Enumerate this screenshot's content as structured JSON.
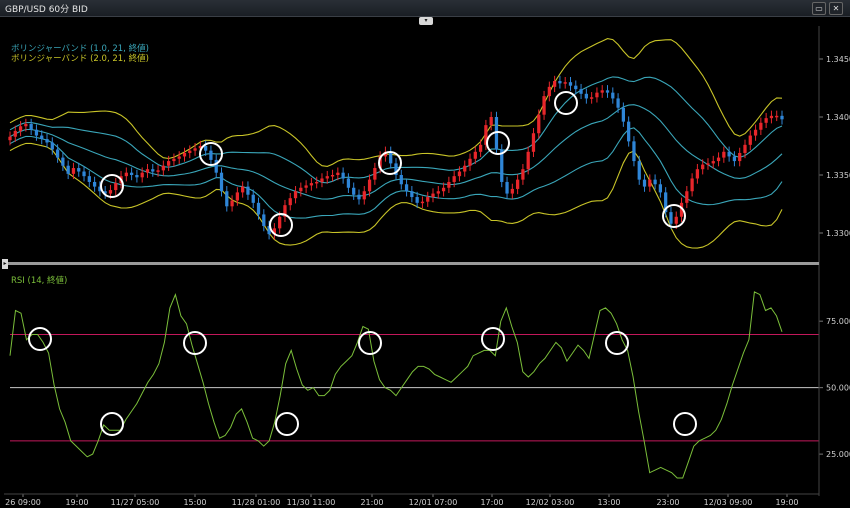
{
  "window": {
    "title": "GBP/USD 60分 BID",
    "close_icon": "close-icon",
    "restore_icon": "restore-icon",
    "collapse_icon": "collapse-icon"
  },
  "colors": {
    "bull": "#e8262b",
    "bear": "#2f86d8",
    "band1": "#3aa6b9",
    "band2": "#c8c428",
    "rsi": "#7bbf3a",
    "rsi_level_hi": "#c2185b",
    "rsi_level_mid": "#c8c8c8",
    "circle": "#ffffff"
  },
  "legend": {
    "bb1": "ボリンジャーバンド (1.0, 21, 終値)",
    "bb2": "ボリンジャーバンド (2.0, 21, 終値)",
    "rsi": "RSI (14, 終値)"
  },
  "chart_data": [
    {
      "type": "candlestick",
      "title": "GBP/USD 60分 BID",
      "ylim": [
        1.3275,
        1.3475
      ],
      "y_ticks": [
        "1.34500",
        "1.34000",
        "1.33500",
        "1.33000"
      ],
      "x_tick_labels": [
        "26 09:00",
        "19:00",
        "11/27 05:00",
        "15:00",
        "11/28 01:00",
        "11/30 11:00",
        "21:00",
        "12/01 07:00",
        "17:00",
        "12/02 03:00",
        "13:00",
        "23:00",
        "12/03 09:00",
        "19:00"
      ],
      "close": [
        1.3383,
        1.3388,
        1.3392,
        1.3394,
        1.3389,
        1.3384,
        1.3381,
        1.3378,
        1.3372,
        1.3365,
        1.3358,
        1.3351,
        1.3356,
        1.3353,
        1.3349,
        1.3344,
        1.334,
        1.3336,
        1.3334,
        1.3337,
        1.3343,
        1.3349,
        1.3352,
        1.335,
        1.3348,
        1.3352,
        1.3355,
        1.3353,
        1.3354,
        1.3358,
        1.3362,
        1.3364,
        1.3366,
        1.3369,
        1.3371,
        1.3373,
        1.3375,
        1.3371,
        1.3363,
        1.3352,
        1.3336,
        1.3323,
        1.3328,
        1.3335,
        1.334,
        1.3333,
        1.3326,
        1.3316,
        1.3306,
        1.3299,
        1.3304,
        1.3314,
        1.3324,
        1.333,
        1.3336,
        1.3339,
        1.3341,
        1.3343,
        1.3344,
        1.3347,
        1.3349,
        1.335,
        1.3352,
        1.3347,
        1.3339,
        1.3333,
        1.3329,
        1.3336,
        1.3346,
        1.3356,
        1.3366,
        1.337,
        1.336,
        1.335,
        1.3342,
        1.3336,
        1.3331,
        1.3326,
        1.3327,
        1.3331,
        1.3334,
        1.3336,
        1.3339,
        1.3344,
        1.3349,
        1.3353,
        1.3358,
        1.3364,
        1.337,
        1.3376,
        1.3393,
        1.34,
        1.3372,
        1.3344,
        1.3334,
        1.3338,
        1.3346,
        1.3355,
        1.337,
        1.3386,
        1.3402,
        1.3418,
        1.3426,
        1.3431,
        1.3429,
        1.343,
        1.3427,
        1.3424,
        1.342,
        1.3416,
        1.3417,
        1.3421,
        1.3423,
        1.3421,
        1.3416,
        1.3408,
        1.3396,
        1.3379,
        1.3362,
        1.3346,
        1.334,
        1.3346,
        1.3342,
        1.3335,
        1.3318,
        1.3308,
        1.3314,
        1.3326,
        1.3336,
        1.3347,
        1.3355,
        1.3359,
        1.336,
        1.3362,
        1.3365,
        1.337,
        1.3366,
        1.3362,
        1.3369,
        1.3376,
        1.3384,
        1.3389,
        1.3395,
        1.3399,
        1.3401,
        1.3401,
        1.3398
      ]
    },
    {
      "type": "line",
      "title": "RSI (14, 終値)",
      "ylim": [
        10,
        95
      ],
      "y_ticks": [
        "75.000",
        "50.000",
        "25.000"
      ],
      "levels": [
        70,
        50,
        30
      ],
      "series": [
        {
          "values": [
            62,
            79,
            78,
            68,
            70,
            70,
            67,
            63,
            51,
            42,
            37,
            30,
            28,
            26,
            24,
            25,
            30,
            36,
            34,
            34,
            34,
            38,
            41,
            44,
            48,
            52,
            55,
            59,
            67,
            80,
            85,
            77,
            74,
            66,
            59,
            52,
            44,
            37,
            31,
            32,
            35,
            40,
            42,
            37,
            31,
            30,
            28,
            30,
            37,
            47,
            59,
            64,
            57,
            51,
            49,
            50,
            47,
            47,
            49,
            55,
            58,
            60,
            62,
            67,
            73,
            72,
            60,
            53,
            50,
            49,
            47,
            50,
            53,
            56,
            58,
            58,
            57,
            55,
            54,
            53,
            52,
            54,
            56,
            58,
            62,
            63,
            64,
            64,
            62,
            75,
            80,
            73,
            67,
            56,
            54,
            56,
            59,
            61,
            64,
            67,
            65,
            60,
            63,
            66,
            64,
            61,
            70,
            79,
            80,
            78,
            74,
            68,
            64,
            54,
            41,
            30,
            18,
            19,
            20,
            19,
            18,
            16,
            16,
            22,
            28,
            30,
            31,
            32,
            34,
            38,
            44,
            51,
            57,
            63,
            68,
            86,
            85,
            79,
            80,
            77,
            71
          ]
        }
      ]
    }
  ]
}
